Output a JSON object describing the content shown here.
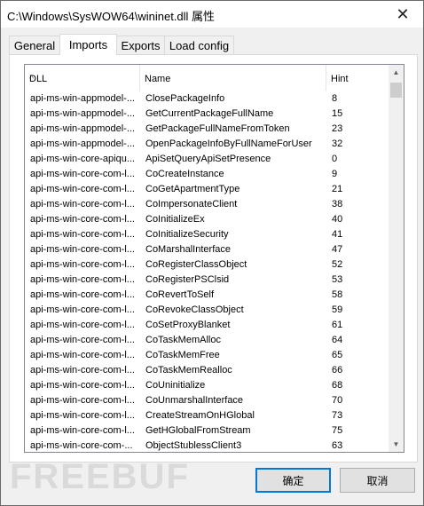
{
  "window": {
    "title": "C:\\Windows\\SysWOW64\\wininet.dll 属性",
    "close_glyph": "✕"
  },
  "tabs": [
    {
      "label": "General",
      "active": false
    },
    {
      "label": "Imports",
      "active": true
    },
    {
      "label": "Exports",
      "active": false
    },
    {
      "label": "Load config",
      "active": false
    }
  ],
  "table": {
    "columns": [
      "DLL",
      "Name",
      "Hint"
    ],
    "sort_indicator": "^",
    "rows": [
      [
        "api-ms-win-appmodel-...",
        "ClosePackageInfo",
        "8"
      ],
      [
        "api-ms-win-appmodel-...",
        "GetCurrentPackageFullName",
        "15"
      ],
      [
        "api-ms-win-appmodel-...",
        "GetPackageFullNameFromToken",
        "23"
      ],
      [
        "api-ms-win-appmodel-...",
        "OpenPackageInfoByFullNameForUser",
        "32"
      ],
      [
        "api-ms-win-core-apiqu...",
        "ApiSetQueryApiSetPresence",
        "0"
      ],
      [
        "api-ms-win-core-com-l...",
        "CoCreateInstance",
        "9"
      ],
      [
        "api-ms-win-core-com-l...",
        "CoGetApartmentType",
        "21"
      ],
      [
        "api-ms-win-core-com-l...",
        "CoImpersonateClient",
        "38"
      ],
      [
        "api-ms-win-core-com-l...",
        "CoInitializeEx",
        "40"
      ],
      [
        "api-ms-win-core-com-l...",
        "CoInitializeSecurity",
        "41"
      ],
      [
        "api-ms-win-core-com-l...",
        "CoMarshalInterface",
        "47"
      ],
      [
        "api-ms-win-core-com-l...",
        "CoRegisterClassObject",
        "52"
      ],
      [
        "api-ms-win-core-com-l...",
        "CoRegisterPSClsid",
        "53"
      ],
      [
        "api-ms-win-core-com-l...",
        "CoRevertToSelf",
        "58"
      ],
      [
        "api-ms-win-core-com-l...",
        "CoRevokeClassObject",
        "59"
      ],
      [
        "api-ms-win-core-com-l...",
        "CoSetProxyBlanket",
        "61"
      ],
      [
        "api-ms-win-core-com-l...",
        "CoTaskMemAlloc",
        "64"
      ],
      [
        "api-ms-win-core-com-l...",
        "CoTaskMemFree",
        "65"
      ],
      [
        "api-ms-win-core-com-l...",
        "CoTaskMemRealloc",
        "66"
      ],
      [
        "api-ms-win-core-com-l...",
        "CoUninitialize",
        "68"
      ],
      [
        "api-ms-win-core-com-l...",
        "CoUnmarshalInterface",
        "70"
      ],
      [
        "api-ms-win-core-com-l...",
        "CreateStreamOnHGlobal",
        "73"
      ],
      [
        "api-ms-win-core-com-l...",
        "GetHGlobalFromStream",
        "75"
      ],
      [
        "api-ms-win-core-com-...",
        "ObjectStublessClient3",
        "63"
      ]
    ]
  },
  "scrollbar": {
    "up_glyph": "▲",
    "down_glyph": "▼"
  },
  "buttons": {
    "ok": "确定",
    "cancel": "取消"
  },
  "watermark": "FREEBUF"
}
